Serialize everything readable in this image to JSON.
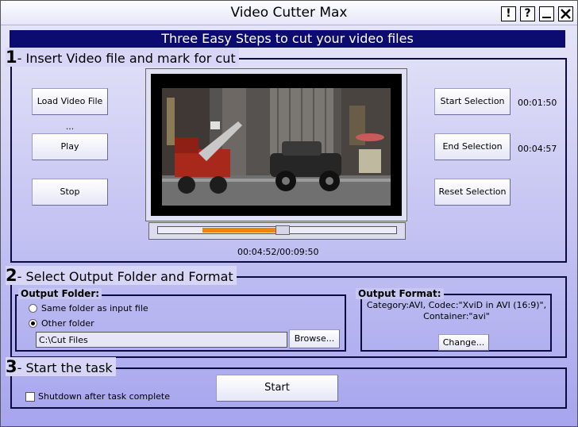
{
  "window": {
    "title": "Video Cutter Max",
    "buttons": [
      "!",
      "?",
      "_",
      "X"
    ]
  },
  "banner": "Three Easy Steps to cut your video files",
  "step1": {
    "number": "1",
    "title": "- Insert Video file and mark for cut",
    "load_label": "Load Video File ...",
    "play_label": "Play",
    "stop_label": "Stop",
    "start_sel_label": "Start Selection",
    "end_sel_label": "End Selection",
    "reset_sel_label": "Reset Selection",
    "start_time": "00:01:50",
    "end_time": "00:04:57",
    "position": "00:04:52/00:09:50",
    "selection_start_fraction": 0.186,
    "selection_end_fraction": 0.503,
    "playhead_fraction": 0.495
  },
  "step2": {
    "number": "2",
    "title": "- Select Output Folder and Format",
    "output_folder": {
      "title": "Output Folder:",
      "same_folder_label": "Same folder as input file",
      "other_folder_label": "Other folder",
      "selected": "other",
      "path": "C:\\Cut Files",
      "browse_label": "Browse..."
    },
    "output_format": {
      "title": "Output Format:",
      "line1": "Category:AVI, Codec:\"XviD in AVI (16:9)\",",
      "line2": "Container:\"avi\"",
      "change_label": "Change..."
    }
  },
  "step3": {
    "number": "3",
    "title": "- Start the task",
    "shutdown_label": "Shutdown after task complete",
    "shutdown_checked": false,
    "start_label": "Start"
  },
  "colors": {
    "banner": "#0b0b70",
    "selection": "#f0820f",
    "background": "#c9c8f3"
  }
}
